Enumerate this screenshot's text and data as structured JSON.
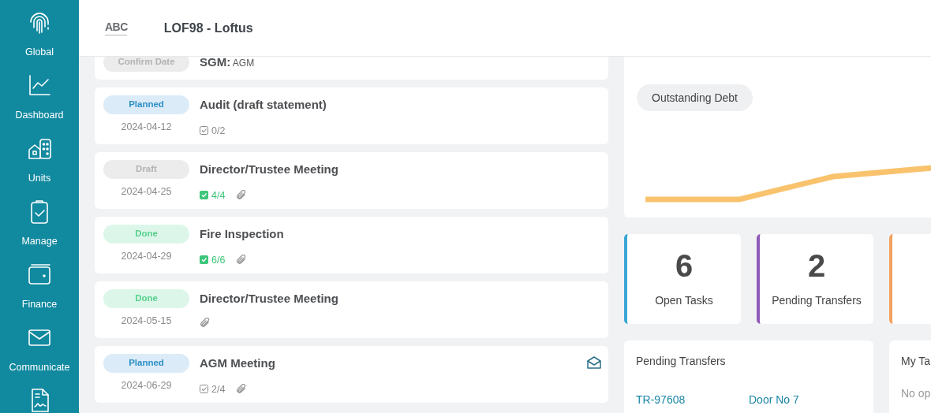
{
  "sidebar": {
    "items": [
      {
        "kind": "nav",
        "label": "Global"
      },
      {
        "kind": "nav",
        "label": "Dashboard"
      },
      {
        "kind": "nav",
        "label": "Units"
      },
      {
        "kind": "nav",
        "label": "Manage"
      },
      {
        "kind": "nav",
        "label": "Finance"
      },
      {
        "kind": "nav",
        "label": "Communicate"
      },
      {
        "kind": "cut"
      }
    ]
  },
  "header": {
    "logo": "ABC",
    "title": "LOF98 - Loftus"
  },
  "meetings": [
    {
      "status": "Confirm Date",
      "kind": "confirm",
      "title": "SGM:",
      "subtitle": "AGM"
    },
    {
      "status": "Planned",
      "kind": "planned",
      "title": "Audit (draft statement)",
      "date": "2024-04-12",
      "tasks": "0/2",
      "tasks_complete": false,
      "attachment": false,
      "mail": false
    },
    {
      "status": "Draft",
      "kind": "draft",
      "title": "Director/Trustee Meeting",
      "date": "2024-04-25",
      "tasks": "4/4",
      "tasks_complete": true,
      "attachment": true,
      "mail": false
    },
    {
      "status": "Done",
      "kind": "done",
      "title": "Fire Inspection",
      "date": "2024-04-29",
      "tasks": "6/6",
      "tasks_complete": true,
      "attachment": true,
      "mail": false
    },
    {
      "status": "Done",
      "kind": "done",
      "title": "Director/Trustee Meeting",
      "date": "2024-05-15",
      "attachment": true,
      "mail": false
    },
    {
      "status": "Planned",
      "kind": "planned",
      "title": "AGM Meeting",
      "date": "2024-06-29",
      "tasks": "2/4",
      "tasks_complete": false,
      "attachment": true,
      "mail": true
    }
  ],
  "chart_panel": {
    "button": "Outstanding Debt"
  },
  "stats": [
    {
      "value": "6",
      "label": "Open Tasks",
      "color": "#3aa6d6"
    },
    {
      "value": "2",
      "label": "Pending Transfers",
      "color": "#8f5bb8"
    },
    {
      "color": "#f2a261"
    }
  ],
  "pending_transfers": {
    "title": "Pending Transfers",
    "rows": [
      {
        "ref": "TR-97608",
        "unit": "Door No 7"
      }
    ]
  },
  "my_tasks": {
    "title": "My Ta",
    "empty": "No op"
  }
}
